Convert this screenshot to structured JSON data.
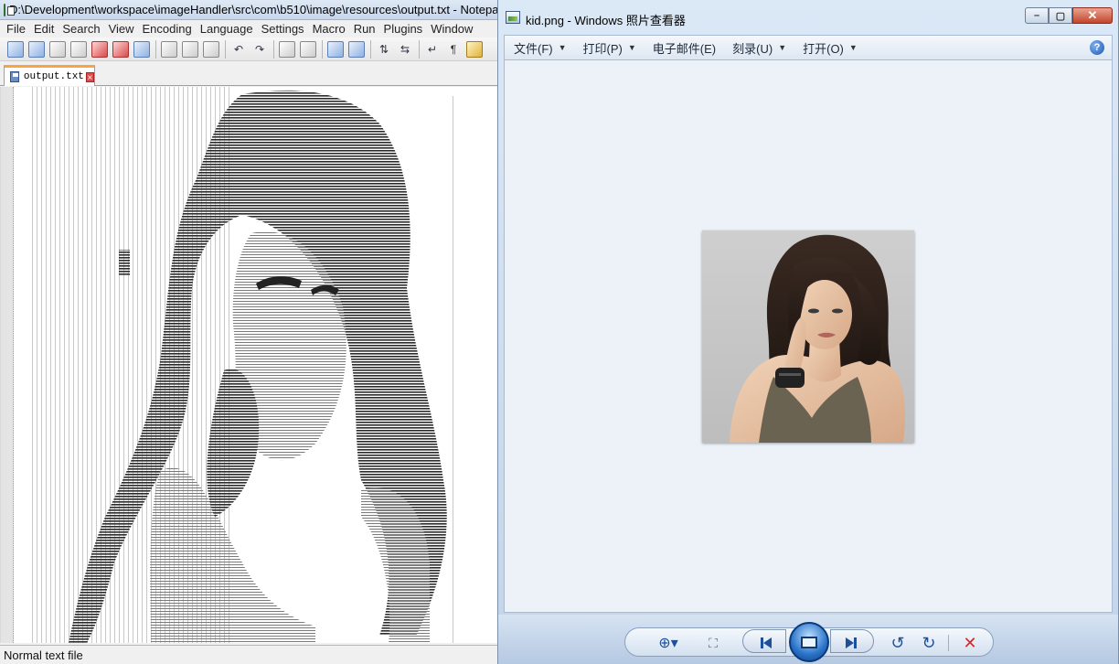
{
  "notepad": {
    "title": "D:\\Development\\workspace\\imageHandler\\src\\com\\b510\\image\\resources\\output.txt - Notepad++ [Administrator]",
    "menu": [
      "File",
      "Edit",
      "Search",
      "View",
      "Encoding",
      "Language",
      "Settings",
      "Macro",
      "Run",
      "Plugins",
      "Window"
    ],
    "toolbar_icons": [
      "new-file-icon",
      "open-file-icon",
      "save-icon",
      "save-all-icon",
      "close-icon",
      "close-all-icon",
      "print-icon",
      "cut-icon",
      "copy-icon",
      "paste-icon",
      "undo-icon",
      "redo-icon",
      "find-icon",
      "replace-icon",
      "zoom-in-icon",
      "zoom-out-icon",
      "sync-vertical-icon",
      "sync-horizontal-icon",
      "word-wrap-icon",
      "show-all-chars-icon",
      "indent-guide-icon"
    ],
    "tab_label": "output.txt",
    "status": "Normal text file"
  },
  "photo_viewer": {
    "title": "kid.png - Windows 照片查看器",
    "menus": [
      {
        "label": "文件(F)",
        "has_arrow": true
      },
      {
        "label": "打印(P)",
        "has_arrow": true
      },
      {
        "label": "电子邮件(E)",
        "has_arrow": false
      },
      {
        "label": "刻录(U)",
        "has_arrow": true
      },
      {
        "label": "打开(O)",
        "has_arrow": true
      }
    ],
    "controls": [
      "zoom-icon",
      "actual-size-icon",
      "previous-icon",
      "slideshow-icon",
      "next-icon",
      "rotate-left-icon",
      "rotate-right-icon",
      "delete-icon"
    ]
  }
}
